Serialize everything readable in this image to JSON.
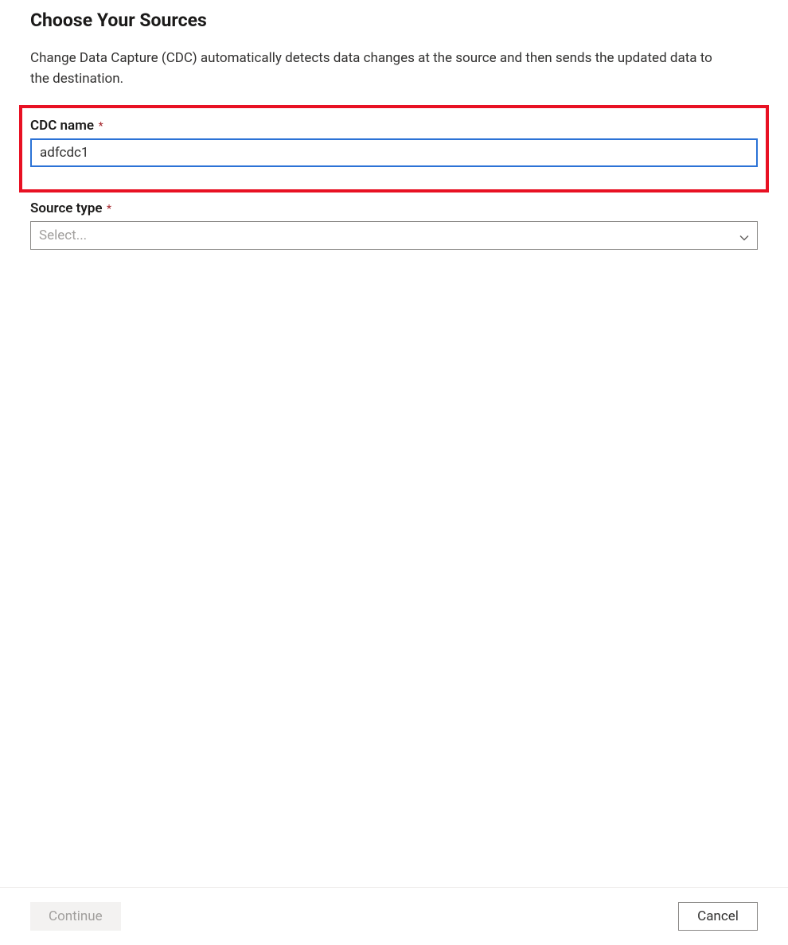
{
  "header": {
    "title": "Choose Your Sources",
    "description": "Change Data Capture (CDC) automatically detects data changes at the source and then sends the updated data to the destination."
  },
  "form": {
    "cdc_name": {
      "label": "CDC name",
      "required_mark": "*",
      "value": "adfcdc1"
    },
    "source_type": {
      "label": "Source type",
      "required_mark": "*",
      "placeholder": "Select..."
    }
  },
  "footer": {
    "continue_label": "Continue",
    "cancel_label": "Cancel"
  }
}
